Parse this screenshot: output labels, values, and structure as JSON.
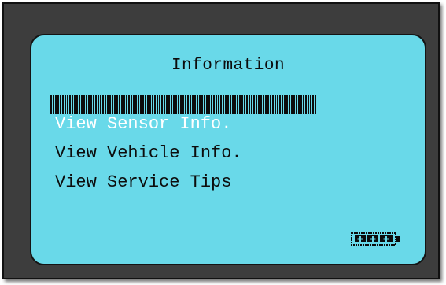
{
  "screen": {
    "title": "Information"
  },
  "menu": {
    "items": [
      {
        "label": "View Sensor Info.",
        "selected": true
      },
      {
        "label": "View Vehicle Info.",
        "selected": false
      },
      {
        "label": "View Service Tips",
        "selected": false
      }
    ]
  },
  "status": {
    "battery_icon": "battery-icon",
    "battery_level": 1.0
  },
  "colors": {
    "lcd_background": "#69d9e9",
    "device_frame": "#3d3d3d",
    "text": "#0c0c0c"
  }
}
